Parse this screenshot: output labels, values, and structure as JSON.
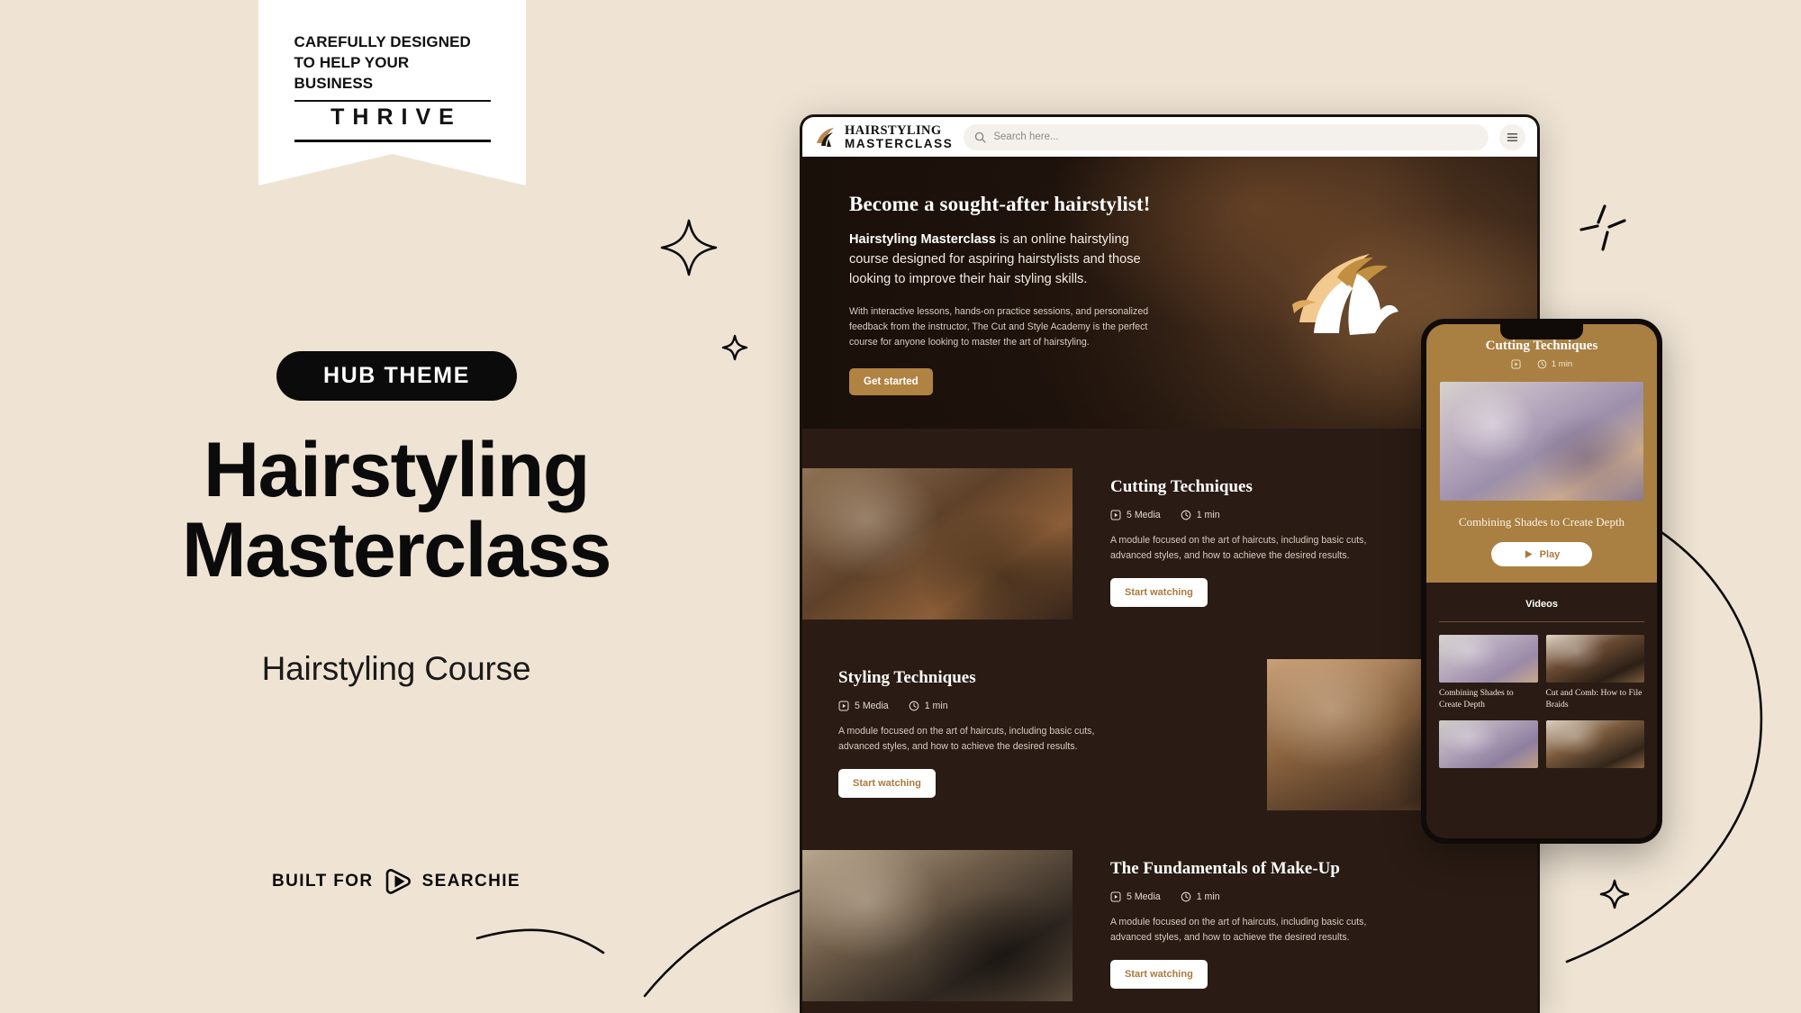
{
  "promo": {
    "flag": {
      "line1": "CAREFULLY DESIGNED",
      "line2": "TO HELP YOUR BUSINESS",
      "word": "THRIVE"
    },
    "badge": "HUB THEME",
    "title": "Hairstyling Masterclass",
    "subtitle": "Hairstyling Course",
    "built_for_label": "BUILT FOR",
    "built_for_brand": "SEARCHIE"
  },
  "browser": {
    "brand_line1": "HAIRSTYLING",
    "brand_line2": "MASTERCLASS",
    "search_placeholder": "Search here...",
    "search_value": "",
    "menu_icon": "hamburger-icon"
  },
  "hero": {
    "heading": "Become a sought-after hairstylist!",
    "lead_strong": "Hairstyling Masterclass",
    "lead_rest": " is an online hairstyling course designed for aspiring hairstylists and those looking to improve their hair styling skills.",
    "body": "With interactive lessons, hands-on practice sessions, and personalized feedback from the instructor, The Cut and Style Academy is the perfect course for anyone looking to master the art of hairstyling.",
    "cta": "Get started"
  },
  "modules": [
    {
      "title": "Cutting Techniques",
      "media": "5 Media",
      "duration": "1 min",
      "description": "A module focused on the art of haircuts, including basic cuts, advanced styles, and how to achieve the desired results.",
      "cta": "Start watching"
    },
    {
      "title": "Styling Techniques",
      "media": "5 Media",
      "duration": "1 min",
      "description": "A module focused on the art of haircuts, including basic cuts, advanced styles, and how to achieve the desired results.",
      "cta": "Start watching"
    },
    {
      "title": "The Fundamentals of Make-Up",
      "media": "5 Media",
      "duration": "1 min",
      "description": "A module focused on the art of haircuts, including basic cuts, advanced styles, and how to achieve the desired results.",
      "cta": "Start watching"
    }
  ],
  "phone": {
    "title": "Cutting Techniques",
    "duration": "1 min",
    "caption": "Combining Shades to Create Depth",
    "play_label": "Play",
    "videos_heading": "Videos",
    "videos": [
      {
        "title": "Combining Shades to Create Depth"
      },
      {
        "title": "Cut and Comb: How to File Braids"
      },
      {
        "title": ""
      },
      {
        "title": ""
      }
    ]
  },
  "colors": {
    "page_bg": "#EFE4D4",
    "ink": "#0B0B0B",
    "gold": "#B08343",
    "phone_gold": "#A97F42",
    "dark_brown": "#2A1C14",
    "link_gold": "#A97A3E"
  }
}
